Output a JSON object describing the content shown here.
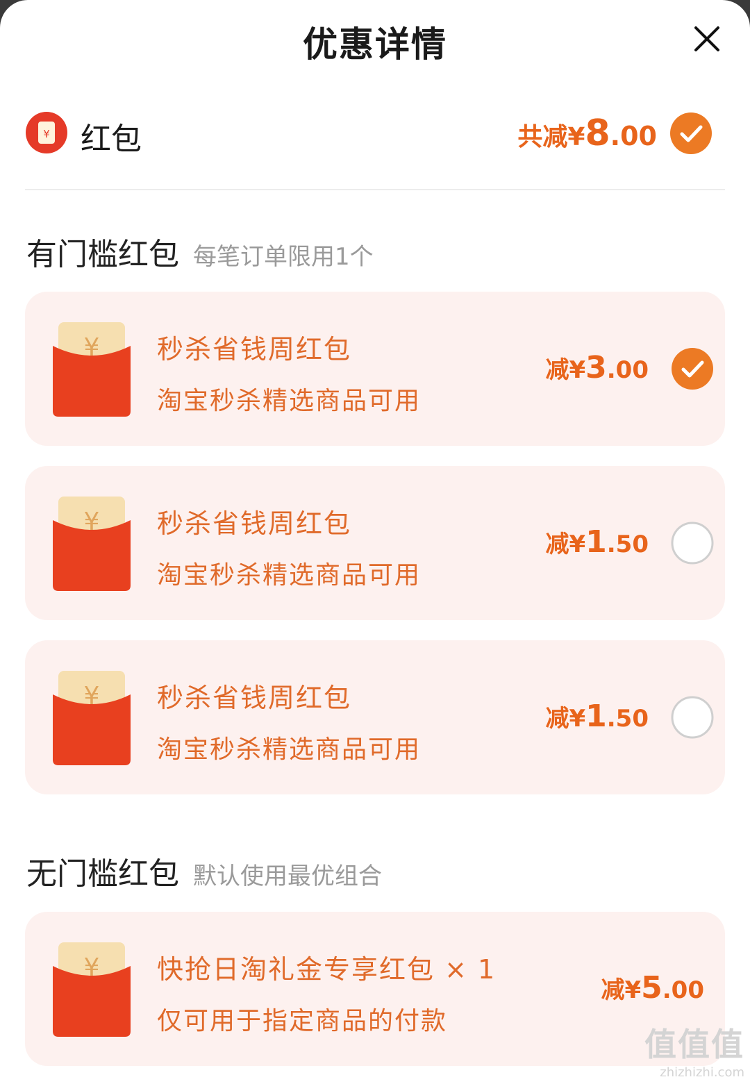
{
  "header": {
    "title": "优惠详情"
  },
  "summary": {
    "label": "红包",
    "total_prefix": "共减¥",
    "total_int": "8",
    "total_dec": ".00",
    "selected": true
  },
  "threshold_section": {
    "title": "有门槛红包",
    "subtitle": "每笔订单限用1个",
    "items": [
      {
        "name": "秒杀省钱周红包",
        "desc": "淘宝秒杀精选商品可用",
        "prefix": "减¥",
        "int": "3",
        "dec": ".00",
        "selected": true
      },
      {
        "name": "秒杀省钱周红包",
        "desc": "淘宝秒杀精选商品可用",
        "prefix": "减¥",
        "int": "1",
        "dec": ".50",
        "selected": false
      },
      {
        "name": "秒杀省钱周红包",
        "desc": "淘宝秒杀精选商品可用",
        "prefix": "减¥",
        "int": "1",
        "dec": ".50",
        "selected": false
      }
    ]
  },
  "no_threshold_section": {
    "title": "无门槛红包",
    "subtitle": "默认使用最优组合",
    "items": [
      {
        "name": "快抢日淘礼金专享红包 × 1",
        "desc": "仅可用于指定商品的付款",
        "prefix": "减¥",
        "int": "5",
        "dec": ".00"
      }
    ]
  },
  "watermark": {
    "mark": "值值值",
    "domain": "zhizhizhi.com"
  },
  "colors": {
    "accent": "#e8641b",
    "card_bg": "#fdf1ef",
    "envelope_red": "#e83a22",
    "envelope_gold": "#f6dfb0"
  },
  "icons": {
    "close": "close-icon",
    "summary": "red-envelope-icon",
    "check": "checkmark-icon"
  }
}
